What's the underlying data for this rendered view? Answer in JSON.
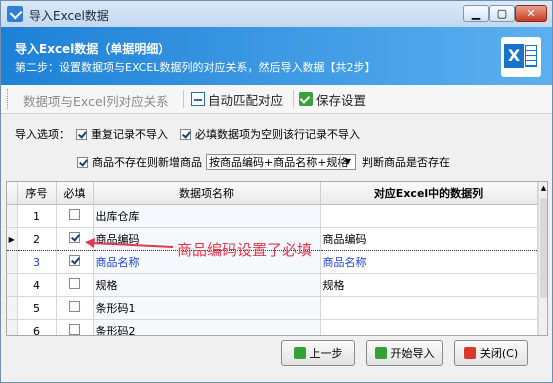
{
  "window": {
    "title": "导入Excel数据"
  },
  "banner": {
    "heading": "导入Excel数据（单据明细）",
    "subheading": "第二步：设置数据项与EXCEL数据列的对应关系，然后导入数据【共2步】"
  },
  "toolbar": {
    "section_label": "数据项与Excel列对应关系",
    "auto_match": "自动匹配对应",
    "save_settings": "保存设置"
  },
  "options": {
    "label": "导入选项：",
    "repeat_skip": {
      "label": "重复记录不导入",
      "checked": true
    },
    "required_empty_skip": {
      "label": "必填数据项为空则该行记录不导入",
      "checked": true
    },
    "new_product": {
      "label": "商品不存在则新增商品",
      "checked": true
    },
    "match_select_value": "按商品编码+商品名称+规格",
    "match_suffix": "判断商品是否存在"
  },
  "grid": {
    "headers": {
      "seq": "序号",
      "required": "必填",
      "item": "数据项名称",
      "column": "对应Excel中的数据列"
    },
    "rows": [
      {
        "seq": "1",
        "required": false,
        "item": "出库仓库",
        "column": ""
      },
      {
        "seq": "2",
        "required": true,
        "item": "商品编码",
        "column": "商品编码"
      },
      {
        "seq": "3",
        "required": true,
        "item": "商品名称",
        "column": "商品名称"
      },
      {
        "seq": "4",
        "required": false,
        "item": "规格",
        "column": "规格"
      },
      {
        "seq": "5",
        "required": false,
        "item": "条形码1",
        "column": ""
      },
      {
        "seq": "6",
        "required": false,
        "item": "条形码2",
        "column": ""
      }
    ]
  },
  "annotation": {
    "text": "商品编码设置了必填"
  },
  "buttons": {
    "prev": "上一步",
    "start": "开始导入",
    "close": "关闭(C)"
  },
  "colors": {
    "banner": "#1d81d6",
    "annotation": "#e03a4e",
    "link_blue": "#1f44d6"
  }
}
